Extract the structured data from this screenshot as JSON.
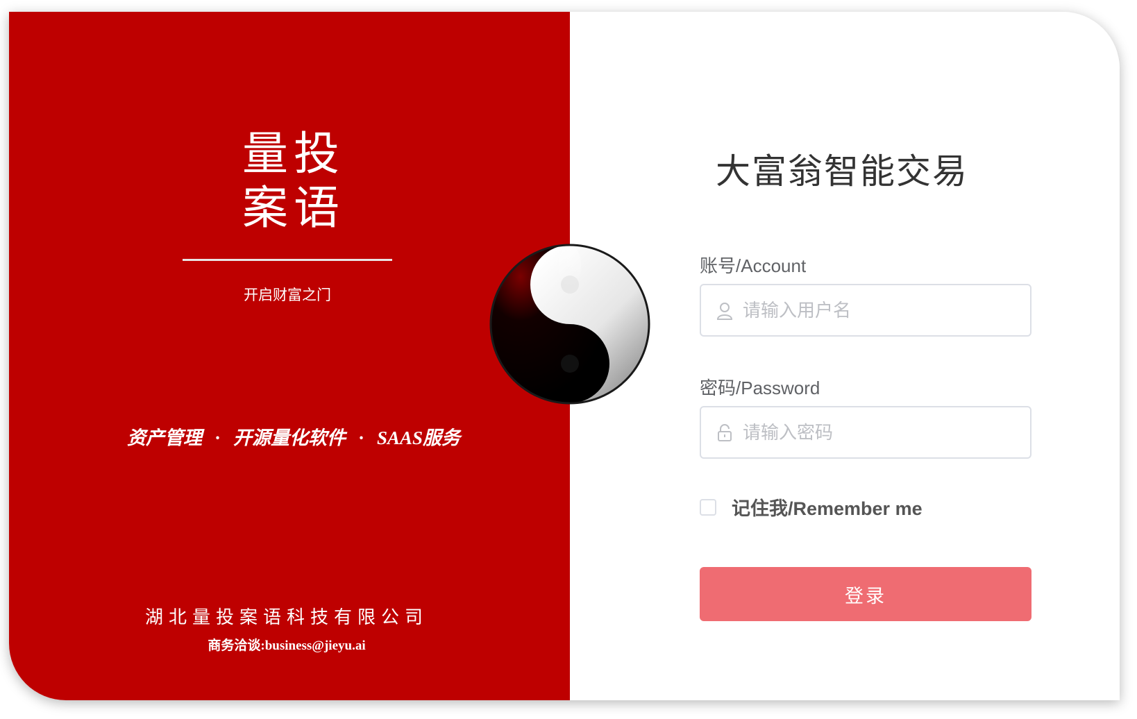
{
  "brand": {
    "line1": "量投",
    "line2": "案语",
    "tagline": "开启财富之门"
  },
  "services": {
    "item1": "资产管理",
    "item2": "开源量化软件",
    "item3": "SAAS服务",
    "separator": "·"
  },
  "footer": {
    "company": "湖北量投案语科技有限公司",
    "contact": "商务洽谈:business@jieyu.ai"
  },
  "login": {
    "title": "大富翁智能交易",
    "account_label": "账号/Account",
    "account_placeholder": "请输入用户名",
    "account_value": "",
    "password_label": "密码/Password",
    "password_placeholder": "请输入密码",
    "password_value": "",
    "remember_label": "记住我/Remember me",
    "remember_checked": false,
    "submit_label": "登录"
  },
  "icons": {
    "emblem": "yin-yang-icon",
    "account": "user-icon",
    "password": "lock-icon"
  },
  "colors": {
    "brand_red": "#be0000",
    "button": "#ef6c72",
    "title_text": "#333333",
    "label_text": "#606266",
    "placeholder": "#bdbfc4",
    "border": "#dcdfe6"
  }
}
